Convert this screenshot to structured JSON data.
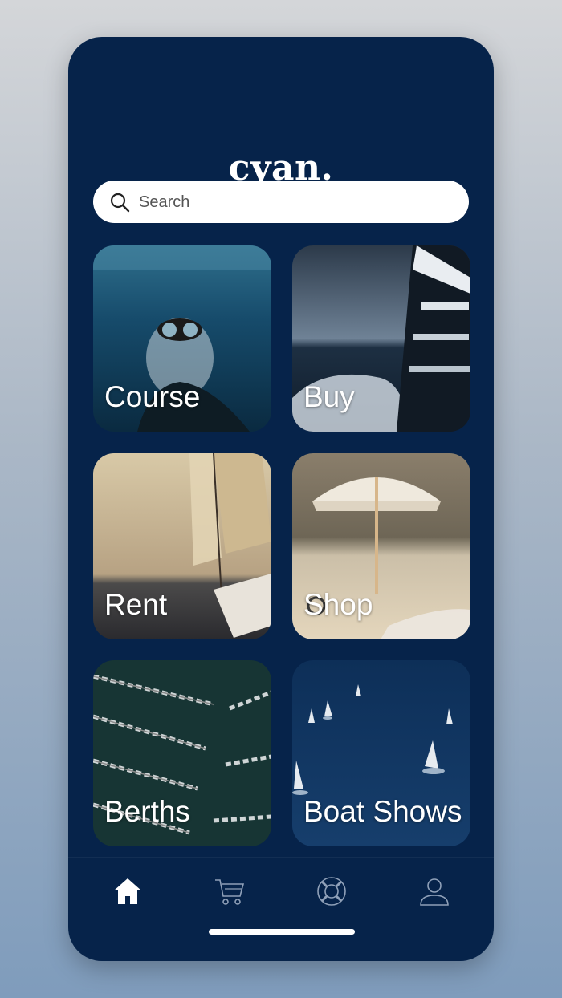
{
  "app": {
    "logo_text": "cyan."
  },
  "search": {
    "placeholder": "Search",
    "value": "",
    "icon": "search-icon"
  },
  "tiles": [
    {
      "label": "Course",
      "image": "diver-underwater"
    },
    {
      "label": "Buy",
      "image": "yacht-side-wake"
    },
    {
      "label": "Rent",
      "image": "sailboat-sunset"
    },
    {
      "label": "Shop",
      "image": "beach-umbrella"
    },
    {
      "label": "Berths",
      "image": "marina-aerial"
    },
    {
      "label": "Boat Shows",
      "image": "sailboats-sea-aerial"
    }
  ],
  "tabbar": {
    "items": [
      {
        "icon": "home-icon",
        "active": true
      },
      {
        "icon": "cart-icon",
        "active": false
      },
      {
        "icon": "lifebuoy-icon",
        "active": false
      },
      {
        "icon": "profile-icon",
        "active": false
      }
    ]
  },
  "colors": {
    "background": "#06234a",
    "search_bg": "#ffffff",
    "active_icon": "#ffffff",
    "inactive_icon": "#8fa0b8"
  }
}
